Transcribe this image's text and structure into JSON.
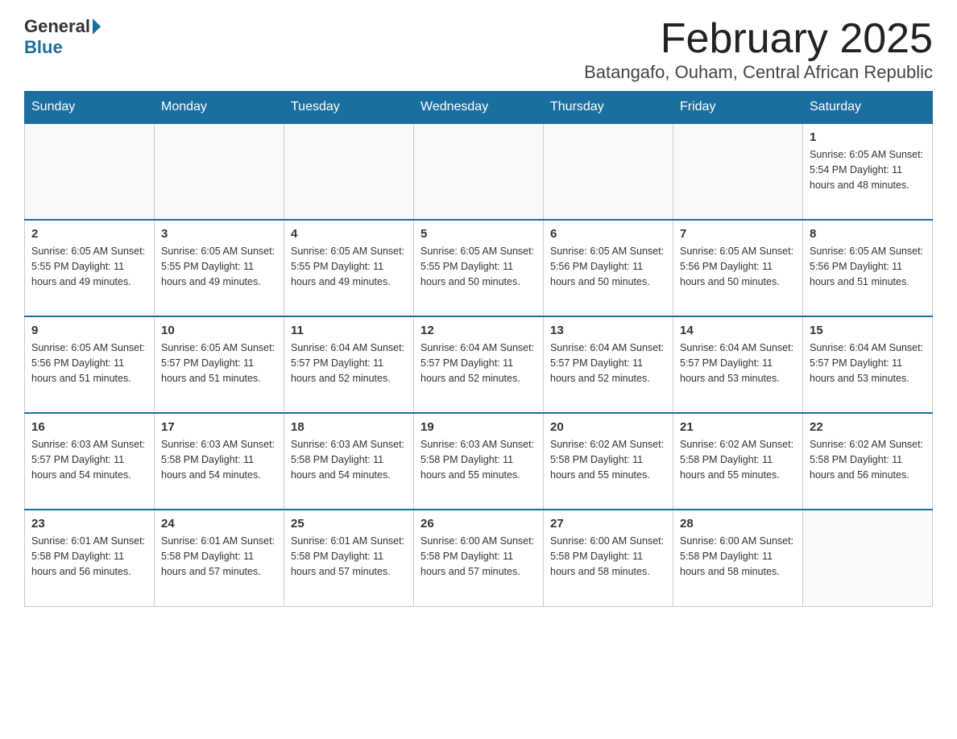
{
  "logo": {
    "general": "General",
    "blue": "Blue"
  },
  "title": "February 2025",
  "subtitle": "Batangafo, Ouham, Central African Republic",
  "days_of_week": [
    "Sunday",
    "Monday",
    "Tuesday",
    "Wednesday",
    "Thursday",
    "Friday",
    "Saturday"
  ],
  "weeks": [
    [
      {
        "day": "",
        "info": ""
      },
      {
        "day": "",
        "info": ""
      },
      {
        "day": "",
        "info": ""
      },
      {
        "day": "",
        "info": ""
      },
      {
        "day": "",
        "info": ""
      },
      {
        "day": "",
        "info": ""
      },
      {
        "day": "1",
        "info": "Sunrise: 6:05 AM\nSunset: 5:54 PM\nDaylight: 11 hours and 48 minutes."
      }
    ],
    [
      {
        "day": "2",
        "info": "Sunrise: 6:05 AM\nSunset: 5:55 PM\nDaylight: 11 hours and 49 minutes."
      },
      {
        "day": "3",
        "info": "Sunrise: 6:05 AM\nSunset: 5:55 PM\nDaylight: 11 hours and 49 minutes."
      },
      {
        "day": "4",
        "info": "Sunrise: 6:05 AM\nSunset: 5:55 PM\nDaylight: 11 hours and 49 minutes."
      },
      {
        "day": "5",
        "info": "Sunrise: 6:05 AM\nSunset: 5:55 PM\nDaylight: 11 hours and 50 minutes."
      },
      {
        "day": "6",
        "info": "Sunrise: 6:05 AM\nSunset: 5:56 PM\nDaylight: 11 hours and 50 minutes."
      },
      {
        "day": "7",
        "info": "Sunrise: 6:05 AM\nSunset: 5:56 PM\nDaylight: 11 hours and 50 minutes."
      },
      {
        "day": "8",
        "info": "Sunrise: 6:05 AM\nSunset: 5:56 PM\nDaylight: 11 hours and 51 minutes."
      }
    ],
    [
      {
        "day": "9",
        "info": "Sunrise: 6:05 AM\nSunset: 5:56 PM\nDaylight: 11 hours and 51 minutes."
      },
      {
        "day": "10",
        "info": "Sunrise: 6:05 AM\nSunset: 5:57 PM\nDaylight: 11 hours and 51 minutes."
      },
      {
        "day": "11",
        "info": "Sunrise: 6:04 AM\nSunset: 5:57 PM\nDaylight: 11 hours and 52 minutes."
      },
      {
        "day": "12",
        "info": "Sunrise: 6:04 AM\nSunset: 5:57 PM\nDaylight: 11 hours and 52 minutes."
      },
      {
        "day": "13",
        "info": "Sunrise: 6:04 AM\nSunset: 5:57 PM\nDaylight: 11 hours and 52 minutes."
      },
      {
        "day": "14",
        "info": "Sunrise: 6:04 AM\nSunset: 5:57 PM\nDaylight: 11 hours and 53 minutes."
      },
      {
        "day": "15",
        "info": "Sunrise: 6:04 AM\nSunset: 5:57 PM\nDaylight: 11 hours and 53 minutes."
      }
    ],
    [
      {
        "day": "16",
        "info": "Sunrise: 6:03 AM\nSunset: 5:57 PM\nDaylight: 11 hours and 54 minutes."
      },
      {
        "day": "17",
        "info": "Sunrise: 6:03 AM\nSunset: 5:58 PM\nDaylight: 11 hours and 54 minutes."
      },
      {
        "day": "18",
        "info": "Sunrise: 6:03 AM\nSunset: 5:58 PM\nDaylight: 11 hours and 54 minutes."
      },
      {
        "day": "19",
        "info": "Sunrise: 6:03 AM\nSunset: 5:58 PM\nDaylight: 11 hours and 55 minutes."
      },
      {
        "day": "20",
        "info": "Sunrise: 6:02 AM\nSunset: 5:58 PM\nDaylight: 11 hours and 55 minutes."
      },
      {
        "day": "21",
        "info": "Sunrise: 6:02 AM\nSunset: 5:58 PM\nDaylight: 11 hours and 55 minutes."
      },
      {
        "day": "22",
        "info": "Sunrise: 6:02 AM\nSunset: 5:58 PM\nDaylight: 11 hours and 56 minutes."
      }
    ],
    [
      {
        "day": "23",
        "info": "Sunrise: 6:01 AM\nSunset: 5:58 PM\nDaylight: 11 hours and 56 minutes."
      },
      {
        "day": "24",
        "info": "Sunrise: 6:01 AM\nSunset: 5:58 PM\nDaylight: 11 hours and 57 minutes."
      },
      {
        "day": "25",
        "info": "Sunrise: 6:01 AM\nSunset: 5:58 PM\nDaylight: 11 hours and 57 minutes."
      },
      {
        "day": "26",
        "info": "Sunrise: 6:00 AM\nSunset: 5:58 PM\nDaylight: 11 hours and 57 minutes."
      },
      {
        "day": "27",
        "info": "Sunrise: 6:00 AM\nSunset: 5:58 PM\nDaylight: 11 hours and 58 minutes."
      },
      {
        "day": "28",
        "info": "Sunrise: 6:00 AM\nSunset: 5:58 PM\nDaylight: 11 hours and 58 minutes."
      },
      {
        "day": "",
        "info": ""
      }
    ]
  ]
}
